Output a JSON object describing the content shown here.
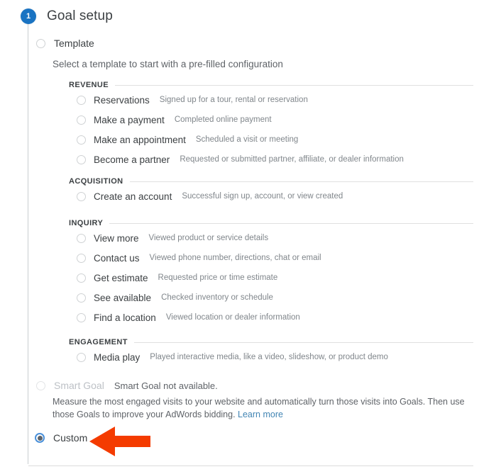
{
  "step": {
    "number": "1",
    "title": "Goal setup"
  },
  "options": {
    "template": {
      "label": "Template",
      "description": "Select a template to start with a pre-filled configuration",
      "selected": false
    },
    "smart_goal": {
      "label": "Smart Goal",
      "note": "Smart Goal not available.",
      "description": "Measure the most engaged visits to your website and automatically turn those visits into Goals. Then use those Goals to improve your AdWords bidding.",
      "link_label": "Learn more",
      "disabled": true,
      "selected": false
    },
    "custom": {
      "label": "Custom",
      "selected": true
    }
  },
  "template_groups": [
    {
      "title": "REVENUE",
      "items": [
        {
          "name": "Reservations",
          "description": "Signed up for a tour, rental or reservation"
        },
        {
          "name": "Make a payment",
          "description": "Completed online payment"
        },
        {
          "name": "Make an appointment",
          "description": "Scheduled a visit or meeting"
        },
        {
          "name": "Become a partner",
          "description": "Requested or submitted partner, affiliate, or dealer information"
        }
      ]
    },
    {
      "title": "ACQUISITION",
      "items": [
        {
          "name": "Create an account",
          "description": "Successful sign up, account, or view created"
        }
      ]
    },
    {
      "title": "INQUIRY",
      "items": [
        {
          "name": "View more",
          "description": "Viewed product or service details"
        },
        {
          "name": "Contact us",
          "description": "Viewed phone number, directions, chat or email"
        },
        {
          "name": "Get estimate",
          "description": "Requested price or time estimate"
        },
        {
          "name": "See available",
          "description": "Checked inventory or schedule"
        },
        {
          "name": "Find a location",
          "description": "Viewed location or dealer information"
        }
      ]
    },
    {
      "title": "ENGAGEMENT",
      "items": [
        {
          "name": "Media play",
          "description": "Played interactive media, like a video, slideshow, or product demo"
        }
      ]
    }
  ],
  "annotation": {
    "arrow": "left-arrow-annotation",
    "color": "#f43b00"
  },
  "colors": {
    "badge": "#1a73c2",
    "link": "#4285b4",
    "selected_radio_ring": "#4a90d9",
    "selected_radio_dot": "#5f6368"
  }
}
